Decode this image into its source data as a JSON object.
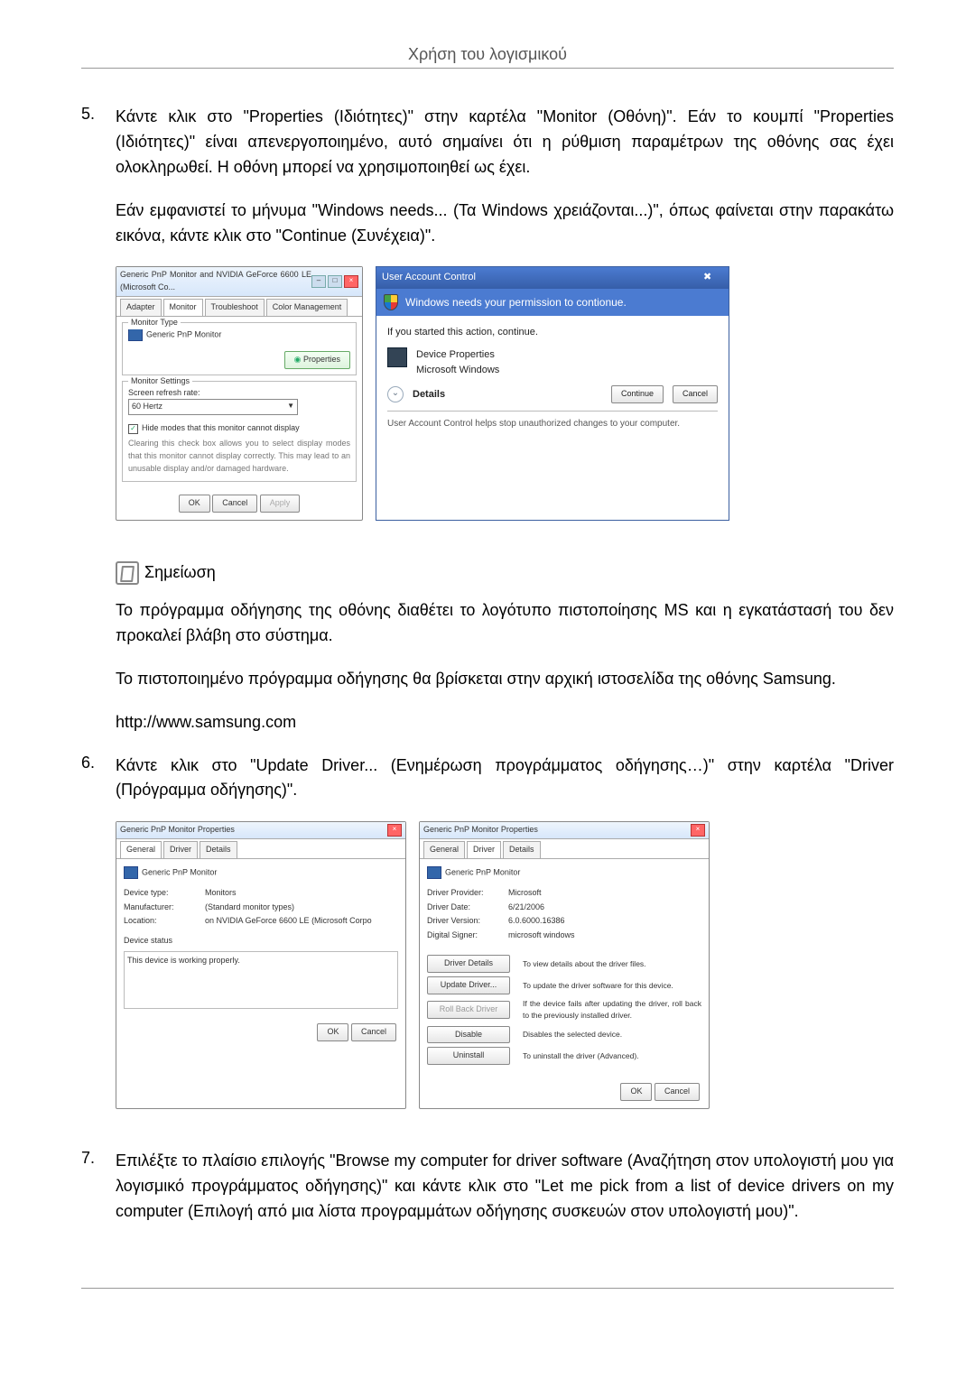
{
  "header": {
    "title": "Χρήση του λογισμικού"
  },
  "step5": {
    "num": "5.",
    "p1": "Κάντε κλικ στο \"Properties (Ιδιότητες)\" στην καρτέλα \"Monitor (Οθόνη)\". Εάν το κουμπί \"Properties (Ιδιότητες)\" είναι απενεργοποιημένο, αυτό σημαίνει ότι η ρύθμιση παραμέτρων της οθόνης σας έχει ολοκληρωθεί. Η οθόνη μπορεί να χρησιμοποιηθεί ως έχει.",
    "p2": "Εάν εμφανιστεί το μήνυμα \"Windows needs... (Τα Windows χρειάζονται...)\", όπως φαίνεται στην παρακάτω εικόνα, κάντε κλικ στο \"Continue (Συνέχεια)\"."
  },
  "shot1": {
    "title": "Generic PnP Monitor and NVIDIA GeForce 6600 LE (Microsoft Co...",
    "tabs": {
      "adapter": "Adapter",
      "monitor": "Monitor",
      "trouble": "Troubleshoot",
      "color": "Color Management"
    },
    "monitorType": "Monitor Type",
    "monitorName": "Generic PnP Monitor",
    "propsBtn": "Properties",
    "monSettings": "Monitor Settings",
    "refreshLabel": "Screen refresh rate:",
    "refreshValue": "60 Hertz",
    "hideModes": "Hide modes that this monitor cannot display",
    "hideDesc": "Clearing this check box allows you to select display modes that this monitor cannot display correctly. This may lead to an unusable display and/or damaged hardware.",
    "ok": "OK",
    "cancel": "Cancel",
    "apply": "Apply"
  },
  "uac": {
    "title": "User Account Control",
    "bar": "Windows needs your permission to contionue.",
    "body1": "If you started this action, continue.",
    "devProps": "Device Properties",
    "msWin": "Microsoft Windows",
    "details": "Details",
    "continue": "Continue",
    "cancel": "Cancel",
    "foot": "User Account Control helps stop unauthorized changes to your computer."
  },
  "note": {
    "label": "Σημείωση",
    "p1": "Το πρόγραμμα οδήγησης της οθόνης διαθέτει το λογότυπο πιστοποίησης MS και η εγκατάστασή του δεν προκαλεί βλάβη στο σύστημα.",
    "p2": "Το πιστοποιημένο πρόγραμμα οδήγησης θα βρίσκεται στην αρχική ιστοσελίδα της οθόνης Samsung.",
    "url": "http://www.samsung.com"
  },
  "step6": {
    "num": "6.",
    "p1": "Κάντε κλικ στο \"Update Driver... (Ενημέρωση προγράμματος οδήγησης…)\" στην καρτέλα \"Driver (Πρόγραμμα οδήγησης)\"."
  },
  "shot3": {
    "title": "Generic PnP Monitor Properties",
    "tabs": {
      "general": "General",
      "driver": "Driver",
      "details": "Details"
    },
    "monitorName": "Generic PnP Monitor",
    "kv": {
      "devTypeK": "Device type:",
      "devTypeV": "Monitors",
      "mfrK": "Manufacturer:",
      "mfrV": "(Standard monitor types)",
      "locK": "Location:",
      "locV": "on NVIDIA GeForce 6600 LE (Microsoft Corpo"
    },
    "statusLabel": "Device status",
    "statusText": "This device is working properly.",
    "ok": "OK",
    "cancel": "Cancel"
  },
  "shot4": {
    "title": "Generic PnP Monitor Properties",
    "tabs": {
      "general": "General",
      "driver": "Driver",
      "details": "Details"
    },
    "monitorName": "Generic PnP Monitor",
    "kv": {
      "provK": "Driver Provider:",
      "provV": "Microsoft",
      "dateK": "Driver Date:",
      "dateV": "6/21/2006",
      "verK": "Driver Version:",
      "verV": "6.0.6000.16386",
      "sigK": "Digital Signer:",
      "sigV": "microsoft windows"
    },
    "btns": {
      "details": "Driver Details",
      "detailsDesc": "To view details about the driver files.",
      "update": "Update Driver...",
      "updateDesc": "To update the driver software for this device.",
      "rollback": "Roll Back Driver",
      "rollbackDesc": "If the device fails after updating the driver, roll back to the previously installed driver.",
      "disable": "Disable",
      "disableDesc": "Disables the selected device.",
      "uninstall": "Uninstall",
      "uninstallDesc": "To uninstall the driver (Advanced)."
    },
    "ok": "OK",
    "cancel": "Cancel"
  },
  "step7": {
    "num": "7.",
    "p1": "Επιλέξτε το πλαίσιο επιλογής \"Browse my computer for driver software (Αναζήτηση στον υπολογιστή μου για λογισμικό προγράμματος οδήγησης)\" και κάντε κλικ στο \"Let me pick from a list of device drivers on my computer (Επιλογή από μια λίστα προγραμμάτων οδήγησης συσκευών στον υπολογιστή μου)\"."
  }
}
